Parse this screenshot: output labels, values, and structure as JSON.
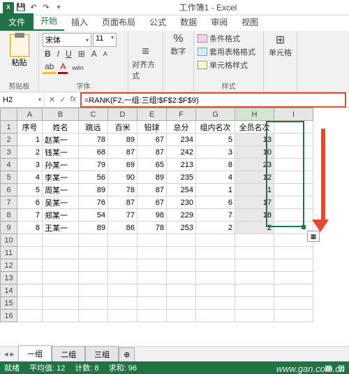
{
  "title": "工作簿1 - Excel",
  "tabs": {
    "file": "文件",
    "home": "开始",
    "insert": "插入",
    "layout": "页面布局",
    "formulas": "公式",
    "data": "数据",
    "review": "审阅",
    "view": "视图"
  },
  "ribbon": {
    "clipboard": {
      "paste": "粘贴",
      "label": "剪贴板"
    },
    "font": {
      "name": "宋体",
      "size": "11",
      "label": "字体"
    },
    "align": {
      "btn": "对齐方式"
    },
    "number": {
      "btn": "数字"
    },
    "styles": {
      "cond": "条件格式",
      "table": "套用表格格式",
      "cell": "单元格样式",
      "label": "样式"
    },
    "cells": {
      "btn": "单元格"
    }
  },
  "namebox": "H2",
  "formula": "=RANK(F2,一组:三组!$F$2:$F$9)",
  "columns": [
    "A",
    "B",
    "C",
    "D",
    "E",
    "F",
    "G",
    "H",
    "I"
  ],
  "headers": [
    "序号",
    "姓名",
    "跳远",
    "百米",
    "铅球",
    "总分",
    "组内名次",
    "全员名次"
  ],
  "rows": [
    {
      "n": 1,
      "name": "赵某一",
      "c": 78,
      "d": 89,
      "e": 67,
      "f": 234,
      "g": 5,
      "h": 13
    },
    {
      "n": 2,
      "name": "钱某一",
      "c": 68,
      "d": 87,
      "e": 87,
      "f": 242,
      "g": 3,
      "h": 10
    },
    {
      "n": 3,
      "name": "孙某一",
      "c": 79,
      "d": 69,
      "e": 65,
      "f": 213,
      "g": 8,
      "h": 23
    },
    {
      "n": 4,
      "name": "李某一",
      "c": 56,
      "d": 90,
      "e": 89,
      "f": 235,
      "g": 4,
      "h": 12
    },
    {
      "n": 5,
      "name": "周某一",
      "c": 89,
      "d": 78,
      "e": 87,
      "f": 254,
      "g": 1,
      "h": 1
    },
    {
      "n": 6,
      "name": "吴某一",
      "c": 76,
      "d": 87,
      "e": 67,
      "f": 230,
      "g": 6,
      "h": 17
    },
    {
      "n": 7,
      "name": "郑某一",
      "c": 54,
      "d": 77,
      "e": 98,
      "f": 229,
      "g": 7,
      "h": 18
    },
    {
      "n": 8,
      "name": "王某一",
      "c": 89,
      "d": 86,
      "e": 78,
      "f": 253,
      "g": 2,
      "h": 2
    }
  ],
  "sheets": {
    "s1": "一组",
    "s2": "二组",
    "s3": "三组"
  },
  "status": {
    "ready": "就绪",
    "avg": "平均值: 12",
    "count": "计数: 8",
    "sum": "求和: 96"
  },
  "watermark": "www.gan.com.cn",
  "chart_data": {
    "type": "table",
    "title": "工作簿1",
    "columns": [
      "序号",
      "姓名",
      "跳远",
      "百米",
      "铅球",
      "总分",
      "组内名次",
      "全员名次"
    ],
    "data": [
      [
        1,
        "赵某一",
        78,
        89,
        67,
        234,
        5,
        13
      ],
      [
        2,
        "钱某一",
        68,
        87,
        87,
        242,
        3,
        10
      ],
      [
        3,
        "孙某一",
        79,
        69,
        65,
        213,
        8,
        23
      ],
      [
        4,
        "李某一",
        56,
        90,
        89,
        235,
        4,
        12
      ],
      [
        5,
        "周某一",
        89,
        78,
        87,
        254,
        1,
        1
      ],
      [
        6,
        "吴某一",
        76,
        87,
        67,
        230,
        6,
        17
      ],
      [
        7,
        "郑某一",
        54,
        77,
        98,
        229,
        7,
        18
      ],
      [
        8,
        "王某一",
        89,
        86,
        78,
        253,
        2,
        2
      ]
    ]
  }
}
